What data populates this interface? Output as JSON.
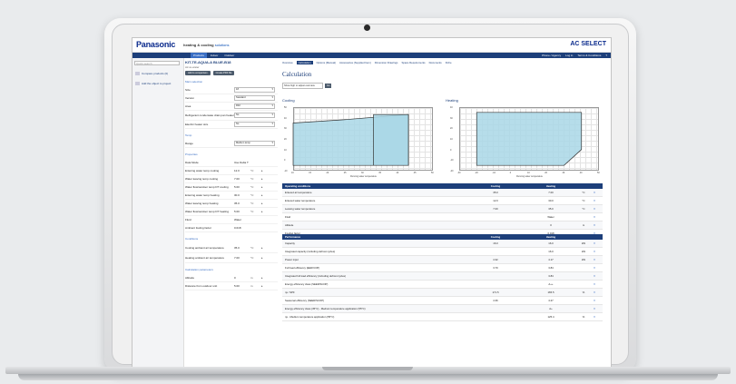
{
  "header": {
    "brand": "Panasonic",
    "tagline_prefix": "heating & cooling",
    "tagline_suffix": "solutions",
    "app_name": "AC SELECT"
  },
  "nav": {
    "tabs": [
      {
        "label": "Products",
        "active": true
      },
      {
        "label": "Indoor",
        "active": false
      },
      {
        "label": "Outdoor",
        "active": false
      }
    ],
    "links": [
      "Phone / Agency",
      "Log in",
      "Terms & Conditions",
      "?"
    ]
  },
  "sidebar": {
    "search_placeholder": "Quick search",
    "items": [
      "Compare products (0)",
      "Add the object to project"
    ]
  },
  "product": {
    "title": "KIT-TE-AQUA-A BLUE-B18",
    "subtitle": "Air-to-water",
    "buttons": [
      "Add to comparison",
      "Create PDF file"
    ],
    "section_main": "Main selection",
    "fields": [
      {
        "label": "Size",
        "value": "18"
      },
      {
        "label": "Version",
        "value": "Standard"
      },
      {
        "label": "Area",
        "value": "R32"
      },
      {
        "label": "Refrigerant condensate drain pan heater",
        "value": "No"
      },
      {
        "label": "Electric heater size",
        "value": "No"
      }
    ],
    "section_temp": "Temp",
    "temp_fields": [
      {
        "label": "Range",
        "value": "Medium temp"
      }
    ],
    "section_properties": "Properties",
    "props_header": {
      "label": "Data Mode",
      "value": "Use Delta T"
    },
    "props": [
      {
        "label": "Entering water temp cooling",
        "value": "12.0",
        "unit": "°C"
      },
      {
        "label": "Water leaving temp cooling",
        "value": "7.00",
        "unit": "°C"
      },
      {
        "label": "Water flow/outdoor temp DT cooling",
        "value": "5.00",
        "unit": "°C"
      },
      {
        "label": "Entering water temp heating",
        "value": "30.0",
        "unit": "°C"
      },
      {
        "label": "Water leaving temp heating",
        "value": "35.0",
        "unit": "°C"
      },
      {
        "label": "Water flow/outdoor temp DT heating",
        "value": "5.00",
        "unit": "°C"
      },
      {
        "label": "Fluid",
        "value": "Water",
        "unit": ""
      },
      {
        "label": "Ambient fouling factor",
        "value": "0.018",
        "unit": ""
      }
    ],
    "section_conditions": "Conditions",
    "conditions": [
      {
        "label": "Cooling ambient air temperature",
        "value": "35.0",
        "unit": "°C"
      },
      {
        "label": "Heating ambient air temperature",
        "value": "7.00",
        "unit": "°C"
      }
    ],
    "section_calc": "Calculation parameters",
    "calc": [
      {
        "label": "Altitude",
        "value": "0",
        "unit": "m"
      },
      {
        "label": "Distance from outdoor unit",
        "value": "5.00",
        "unit": "m"
      }
    ]
  },
  "main": {
    "tabs": [
      "Overview",
      "Calculation",
      "Options (Manual)",
      "Accessories (Supplied Item)",
      "Dimension Drawings",
      "Space Requirements",
      "Documents",
      "Fiche"
    ],
    "active_tab": "Calculation",
    "title": "Calculation",
    "dropdown_value": "Show high or adjust overview",
    "go_label": "Go",
    "chart_cooling_title": "Cooling",
    "chart_heating_title": "Heating",
    "chart_cooling_xlabel": "Running water temperature",
    "chart_heating_xlabel": "Running water temperature",
    "chart_ylabel": "Air temperature"
  },
  "chart_data": [
    {
      "type": "area",
      "title": "Cooling",
      "xlabel": "Running water temperature",
      "ylabel": "Air temperature",
      "x_ticks": [
        "10",
        "15",
        "20",
        "25",
        "30",
        "35",
        "40",
        "45",
        "50"
      ],
      "y_ticks": [
        "-10",
        "0",
        "10",
        "20",
        "30",
        "40",
        "50"
      ],
      "xlim": [
        10,
        50
      ],
      "ylim": [
        -10,
        50
      ],
      "regions": [
        {
          "name": "Main operation",
          "points": [
            [
              10,
              35
            ],
            [
              24,
              38
            ],
            [
              43,
              43
            ],
            [
              43,
              -5
            ],
            [
              10,
              -5
            ]
          ]
        },
        {
          "name": "Extended",
          "points": [
            [
              33,
              43
            ],
            [
              43,
              43
            ],
            [
              43,
              -5
            ],
            [
              33,
              -5
            ]
          ]
        }
      ],
      "grid": true
    },
    {
      "type": "area",
      "title": "Heating",
      "xlabel": "Running water temperature",
      "ylabel": "Air temperature",
      "x_ticks": [
        "-30",
        "-20",
        "-10",
        "0",
        "10",
        "20",
        "30",
        "40",
        "50"
      ],
      "y_ticks": [
        "-20",
        "-10",
        "0",
        "10",
        "20",
        "30",
        "40"
      ],
      "xlim": [
        -30,
        50
      ],
      "ylim": [
        -20,
        40
      ],
      "regions": [
        {
          "name": "Heating",
          "points": [
            [
              -20,
              35
            ],
            [
              40,
              35
            ],
            [
              40,
              0
            ],
            [
              30,
              -15
            ],
            [
              -20,
              -15
            ]
          ]
        }
      ],
      "grid": true
    }
  ],
  "operating_table": {
    "columns": [
      "Operating conditions",
      "Cooling",
      "Heating"
    ],
    "rows": [
      {
        "label": "Entered air temperature",
        "cool": "35.0",
        "heat": "7.00",
        "unit": "°C"
      },
      {
        "label": "Entered water temperature",
        "cool": "12.0",
        "heat": "30.0",
        "unit": "°C"
      },
      {
        "label": "Leaving water temperature",
        "cool": "7.00",
        "heat": "35.0",
        "unit": "°C"
      },
      {
        "label": "Fluid",
        "cool": "",
        "heat": "Water",
        "unit": ""
      },
      {
        "label": "Altitude",
        "cool": "",
        "heat": "0",
        "unit": "m"
      },
      {
        "label": "Fouling factor",
        "cool": "",
        "heat": "0.018",
        "unit": ""
      }
    ]
  },
  "performance_table": {
    "columns": [
      "Performance",
      "Cooling",
      "Heating"
    ],
    "rows": [
      {
        "label": "Capacity",
        "cool": "16.0",
        "heat": "16.0",
        "unit": "kW"
      },
      {
        "label": "Integrated capacity (including defrost cycles)",
        "cool": "",
        "heat": "16.0",
        "unit": "kW"
      },
      {
        "label": "Power input",
        "cool": "4.32",
        "heat": "4.17",
        "unit": "kW"
      },
      {
        "label": "Full load efficiency (EER/COP)",
        "cool": "3.70",
        "heat": "3.84",
        "unit": ""
      },
      {
        "label": "Integrated full load efficiency (including defrost cycles)",
        "cool": "",
        "heat": "3.84",
        "unit": ""
      },
      {
        "label": "Energy efficiency class (SEER/SCOP)",
        "cool": "",
        "heat": "A++",
        "unit": ""
      },
      {
        "label": "ηs / SPF",
        "cool": "171.5",
        "heat": "165.5",
        "unit": "%"
      },
      {
        "label": "Seasonal efficiency (SEER/SCOP)",
        "cool": "4.36",
        "heat": "4.27",
        "unit": ""
      },
      {
        "label": "Energy efficiency class (35°C) - Medium temperature application (55°C)",
        "cool": "",
        "heat": "A+",
        "unit": ""
      },
      {
        "label": "ηs - Medium temperature application (55°C)",
        "cool": "",
        "heat": "125.4",
        "unit": "%"
      }
    ]
  },
  "colors": {
    "nav": "#1d3f7a",
    "accent": "#3b6fc4",
    "region_fill": "#a9d7e6",
    "background": "#e9ebed"
  }
}
